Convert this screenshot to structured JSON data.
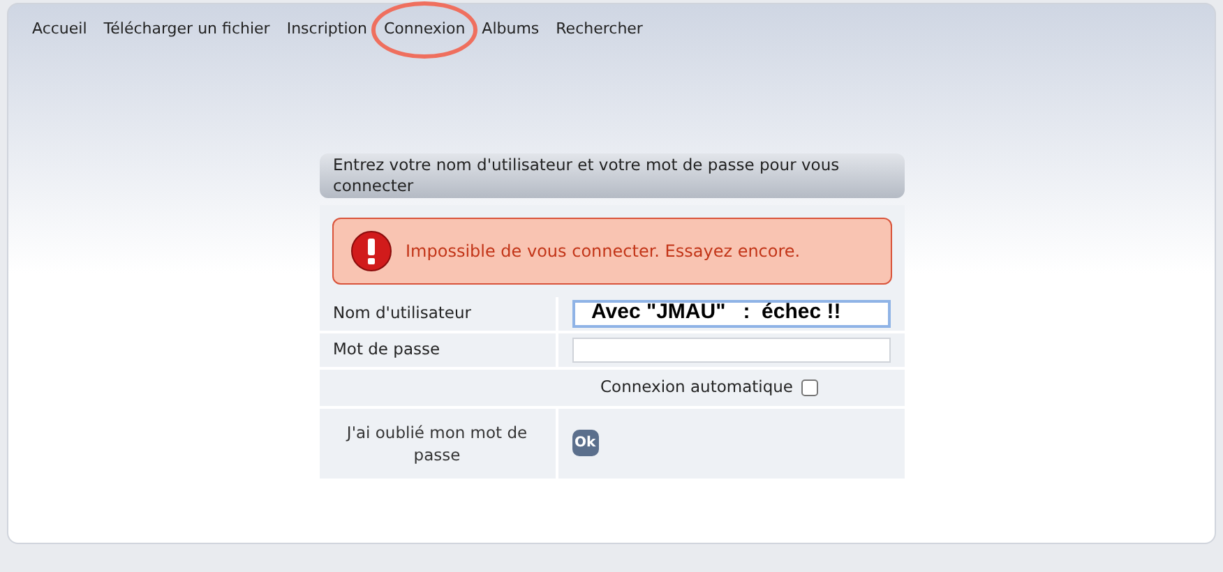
{
  "nav": [
    {
      "label": "Accueil",
      "circled": false
    },
    {
      "label": "Télécharger un fichier",
      "circled": false
    },
    {
      "label": "Inscription",
      "circled": false
    },
    {
      "label": "Connexion",
      "circled": true
    },
    {
      "label": "Albums",
      "circled": false
    },
    {
      "label": "Rechercher",
      "circled": false
    }
  ],
  "login": {
    "heading": "Entrez votre nom d'utilisateur et votre mot de passe pour vous connecter",
    "error": "Impossible de vous connecter. Essayez encore.",
    "username_label": "Nom d'utilisateur",
    "username_value": "Avec \"JMAU\"   :  échec !!",
    "password_label": "Mot de passe",
    "auto_label": "Connexion automatique",
    "auto_checked": false,
    "forgot_label": "J'ai oublié mon mot de passe",
    "ok_button": "Ok"
  }
}
